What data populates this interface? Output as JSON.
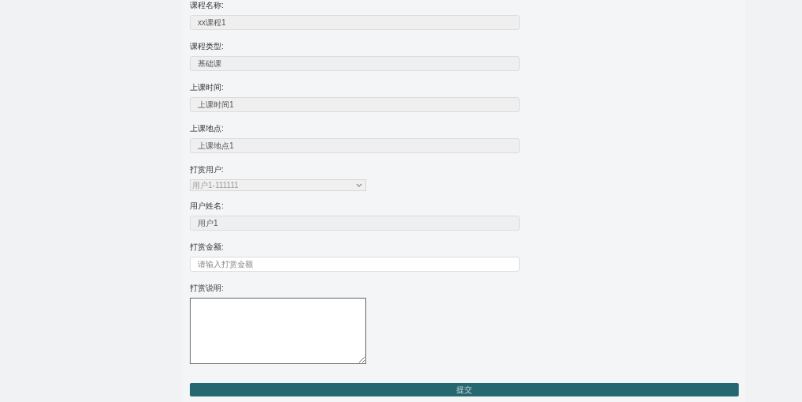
{
  "form": {
    "fields": [
      {
        "kind": "readonly",
        "label": "课程名称:",
        "value": "xx课程1"
      },
      {
        "kind": "readonly",
        "label": "课程类型:",
        "value": "基础课"
      },
      {
        "kind": "readonly",
        "label": "上课时间:",
        "value": "上课时间1"
      },
      {
        "kind": "readonly",
        "label": "上课地点:",
        "value": "上课地点1"
      },
      {
        "kind": "select",
        "label": "打赏用户:",
        "value": "用户1-111111",
        "disabled": true
      },
      {
        "kind": "readonly",
        "label": "用户姓名:",
        "value": "用户1"
      },
      {
        "kind": "input",
        "label": "打赏金额:",
        "placeholder": "请输入打赏金额"
      },
      {
        "kind": "textarea",
        "label": "打赏说明:"
      }
    ],
    "submit": "提交"
  }
}
